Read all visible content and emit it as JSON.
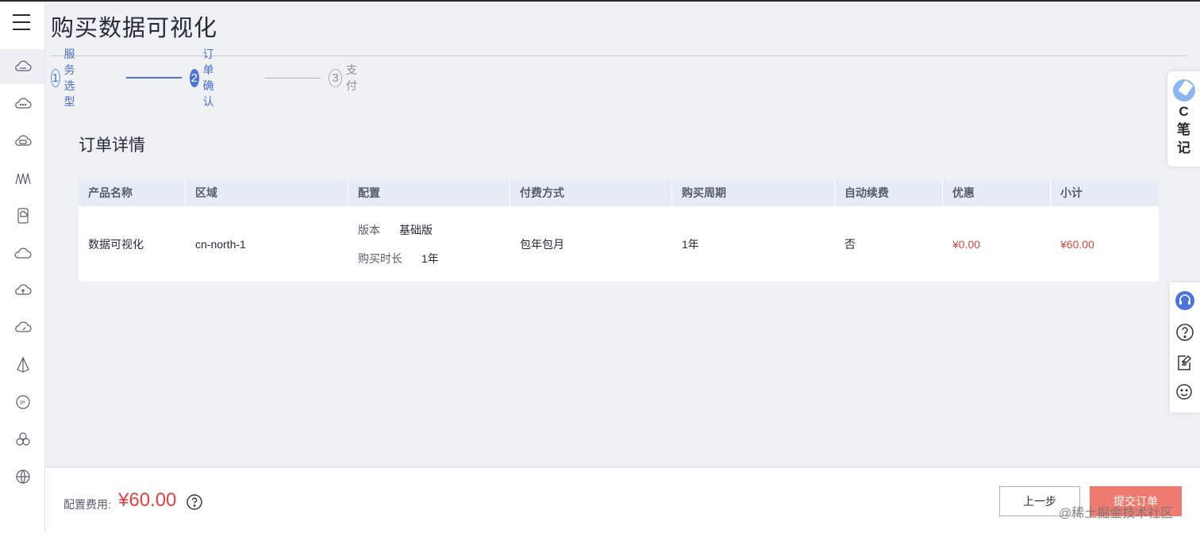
{
  "header": {
    "title": "购买数据可视化"
  },
  "steps": [
    {
      "num": "1",
      "label": "服务选型"
    },
    {
      "num": "2",
      "label": "订单确认"
    },
    {
      "num": "3",
      "label": "支付"
    }
  ],
  "order": {
    "section_title": "订单详情",
    "columns": [
      "产品名称",
      "区域",
      "配置",
      "付费方式",
      "购买周期",
      "自动续费",
      "优惠",
      "小计"
    ],
    "row": {
      "product": "数据可视化",
      "region": "cn-north-1",
      "config": {
        "version_label": "版本",
        "version_value": "基础版",
        "duration_label": "购买时长",
        "duration_value": "1年"
      },
      "payment": "包年包月",
      "period": "1年",
      "auto_renew": "否",
      "discount": "¥0.00",
      "subtotal": "¥60.00"
    }
  },
  "footer": {
    "fee_label": "配置费用:",
    "fee_value": "¥60.00",
    "prev_label": "上一步",
    "submit_label": "提交订单"
  },
  "float_note": {
    "line1": "C",
    "line2": "笔",
    "line3": "记"
  },
  "watermark": "@稀土掘金技术社区",
  "colors": {
    "accent": "#4c73d9",
    "price_red": "#e5403f",
    "submit_bg": "#ef7a70"
  }
}
